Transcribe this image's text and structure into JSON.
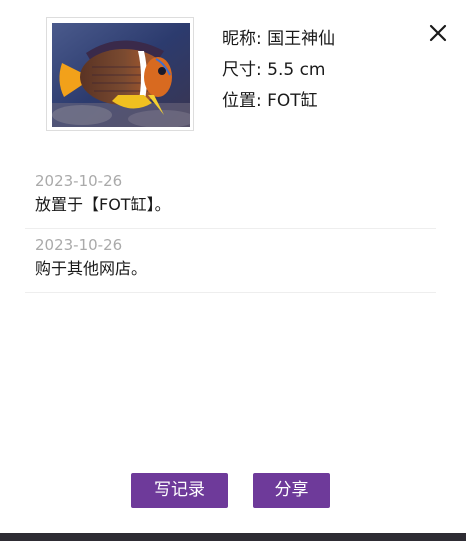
{
  "fish": {
    "nickname_line": "昵称: 国王神仙",
    "size_line": "尺寸: 5.5 cm",
    "location_line": "位置: FOT缸",
    "photo_icon": "fish-photo"
  },
  "records": [
    {
      "date": "2023-10-26",
      "text": "放置于【FOT缸】。"
    },
    {
      "date": "2023-10-26",
      "text": "购于其他网店。"
    }
  ],
  "actions": {
    "write_label": "写记录",
    "share_label": "分享"
  },
  "icons": {
    "close": "close-icon"
  },
  "colors": {
    "accent": "#6e3a9a",
    "date_text": "#aaaaaa",
    "bottom_bar": "#2e2c33"
  }
}
